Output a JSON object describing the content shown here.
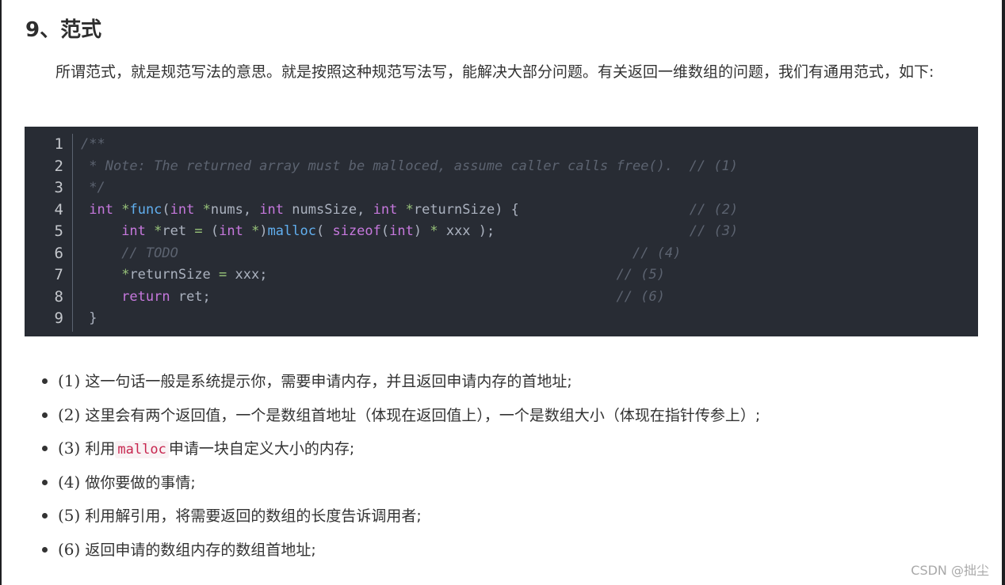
{
  "heading": "9、范式",
  "intro": "所谓范式，就是规范写法的意思。就是按照这种规范写法写，能解决大部分问题。有关返回一维数组的问题，我们有通用范式，如下:",
  "code": {
    "line_numbers": [
      "1",
      "2",
      "3",
      "4",
      "5",
      "6",
      "7",
      "8",
      "9"
    ],
    "lines": [
      [
        {
          "t": "/**",
          "c": "cmt"
        }
      ],
      [
        {
          "t": " * Note: The returned array must be malloced, assume caller calls free().  // (1)",
          "c": "cmt"
        }
      ],
      [
        {
          "t": " */",
          "c": "cmt"
        }
      ],
      [
        {
          "t": " ",
          "c": ""
        },
        {
          "t": "int",
          "c": "kw"
        },
        {
          "t": " ",
          "c": ""
        },
        {
          "t": "*",
          "c": "op"
        },
        {
          "t": "func",
          "c": "fn"
        },
        {
          "t": "(",
          "c": ""
        },
        {
          "t": "int",
          "c": "kw"
        },
        {
          "t": " ",
          "c": ""
        },
        {
          "t": "*",
          "c": "op"
        },
        {
          "t": "nums, ",
          "c": ""
        },
        {
          "t": "int",
          "c": "kw"
        },
        {
          "t": " numsSize, ",
          "c": ""
        },
        {
          "t": "int",
          "c": "kw"
        },
        {
          "t": " ",
          "c": ""
        },
        {
          "t": "*",
          "c": "op"
        },
        {
          "t": "returnSize) {                     ",
          "c": ""
        },
        {
          "t": "// (2)",
          "c": "cmt"
        }
      ],
      [
        {
          "t": "     ",
          "c": ""
        },
        {
          "t": "int",
          "c": "kw"
        },
        {
          "t": " ",
          "c": ""
        },
        {
          "t": "*",
          "c": "op"
        },
        {
          "t": "ret ",
          "c": ""
        },
        {
          "t": "=",
          "c": "op"
        },
        {
          "t": " (",
          "c": ""
        },
        {
          "t": "int",
          "c": "kw"
        },
        {
          "t": " ",
          "c": ""
        },
        {
          "t": "*",
          "c": "op"
        },
        {
          "t": ")",
          "c": ""
        },
        {
          "t": "malloc",
          "c": "fn"
        },
        {
          "t": "( ",
          "c": ""
        },
        {
          "t": "sizeof",
          "c": "kw"
        },
        {
          "t": "(",
          "c": ""
        },
        {
          "t": "int",
          "c": "kw"
        },
        {
          "t": ") ",
          "c": ""
        },
        {
          "t": "*",
          "c": "op"
        },
        {
          "t": " xxx );                        ",
          "c": ""
        },
        {
          "t": "// (3)",
          "c": "cmt"
        }
      ],
      [
        {
          "t": "     ",
          "c": ""
        },
        {
          "t": "// TODO                                                        // (4)",
          "c": "cmt"
        }
      ],
      [
        {
          "t": "     ",
          "c": ""
        },
        {
          "t": "*",
          "c": "op"
        },
        {
          "t": "returnSize ",
          "c": ""
        },
        {
          "t": "=",
          "c": "op"
        },
        {
          "t": " xxx;                                           ",
          "c": ""
        },
        {
          "t": "// (5)",
          "c": "cmt"
        }
      ],
      [
        {
          "t": "     ",
          "c": ""
        },
        {
          "t": "return",
          "c": "kw"
        },
        {
          "t": " ret;                                                  ",
          "c": ""
        },
        {
          "t": "// (6)",
          "c": "cmt"
        }
      ],
      [
        {
          "t": " }",
          "c": ""
        }
      ]
    ]
  },
  "bullets": [
    {
      "num": "(1)",
      "parts": [
        {
          "t": "这一句话一般是系统提示你，需要申请内存，并且返回申请内存的首地址;",
          "code": false
        }
      ]
    },
    {
      "num": "(2)",
      "parts": [
        {
          "t": "这里会有两个返回值，一个是数组首地址（体现在返回值上），一个是数组大小（体现在指针传参上）;",
          "code": false
        }
      ]
    },
    {
      "num": "(3)",
      "parts": [
        {
          "t": "利用",
          "code": false
        },
        {
          "t": "malloc",
          "code": true
        },
        {
          "t": "申请一块自定义大小的内存;",
          "code": false
        }
      ]
    },
    {
      "num": "(4)",
      "parts": [
        {
          "t": "做你要做的事情;",
          "code": false
        }
      ]
    },
    {
      "num": "(5)",
      "parts": [
        {
          "t": "利用解引用，将需要返回的数组的长度告诉调用者;",
          "code": false
        }
      ]
    },
    {
      "num": "(6)",
      "parts": [
        {
          "t": "返回申请的数组内存的数组首地址;",
          "code": false
        }
      ]
    }
  ],
  "watermark": "CSDN @拙尘",
  "colors": {
    "code_bg": "#282c34",
    "keyword": "#c678dd",
    "function": "#61afef",
    "operator": "#98c379",
    "comment": "#5c6370",
    "inline_code": "#c7254e"
  }
}
